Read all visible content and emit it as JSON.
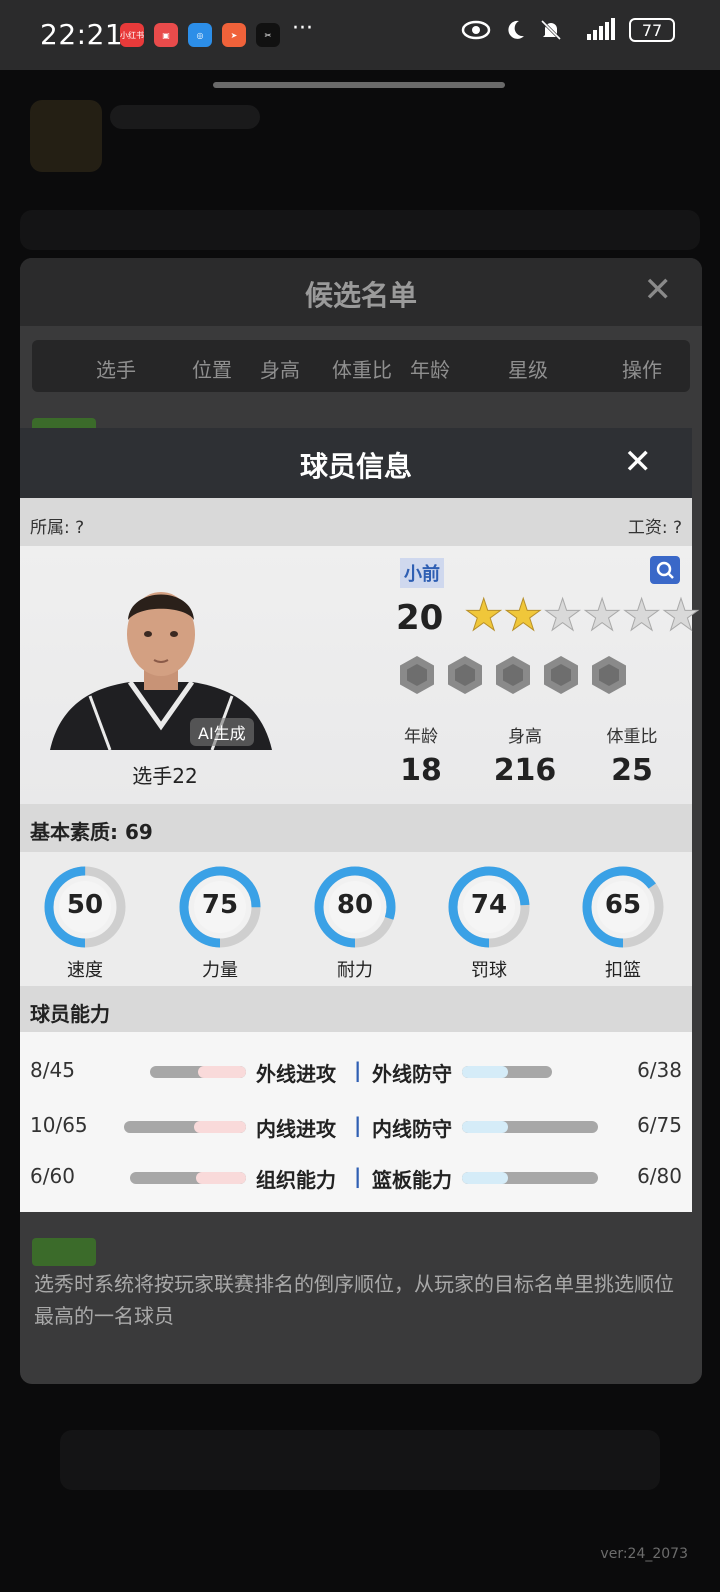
{
  "status_bar": {
    "time": "22:21",
    "apps": [
      {
        "icon": "xiaohongshu-icon",
        "label": "小红书",
        "color": "#e83a3a"
      },
      {
        "icon": "calendar-app-icon",
        "label": "",
        "color": "#e94b4b"
      },
      {
        "icon": "browser-icon",
        "label": "",
        "color": "#2c8ee8"
      },
      {
        "icon": "send-app-icon",
        "label": "",
        "color": "#f0623a"
      },
      {
        "icon": "capcut-icon",
        "label": "",
        "color": "#111111"
      }
    ],
    "more": "···",
    "battery": "77"
  },
  "candidate_list": {
    "title": "候选名单",
    "close_label": "✕",
    "columns": [
      "选手",
      "位置",
      "身高",
      "体重比",
      "年龄",
      "星级",
      "操作"
    ],
    "rule_text": "选秀时系统将按玩家联赛排名的倒序顺位，从玩家的目标名单里挑选顺位最高的一名球员"
  },
  "player_info": {
    "title": "球员信息",
    "close_label": "✕",
    "belong": "所属: ?",
    "salary": "工资: ?",
    "position": "小前",
    "overall": "20",
    "stars": {
      "filled": 2,
      "total": 6
    },
    "ai_badge": "AI生成",
    "name": "选手22",
    "attrs": [
      {
        "label": "年龄",
        "value": "18"
      },
      {
        "label": "身高",
        "value": "216"
      },
      {
        "label": "体重比",
        "value": "25"
      }
    ],
    "basic_quality_label": "基本素质: 69",
    "basic_stats": [
      {
        "label": "速度",
        "value": 50
      },
      {
        "label": "力量",
        "value": 75
      },
      {
        "label": "耐力",
        "value": 80
      },
      {
        "label": "罚球",
        "value": 74
      },
      {
        "label": "扣篮",
        "value": 65
      }
    ],
    "ability_label": "球员能力",
    "abilities": [
      {
        "left_value": "8/45",
        "left_name": "外线进攻",
        "right_name": "外线防守",
        "right_value": "6/38"
      },
      {
        "left_value": "10/65",
        "left_name": "内线进攻",
        "right_name": "内线防守",
        "right_value": "6/75"
      },
      {
        "left_value": "6/60",
        "left_name": "组织能力",
        "right_name": "篮板能力",
        "right_value": "6/80"
      }
    ]
  },
  "version": "ver:24_2073",
  "colors": {
    "ring": "#3aa1e6",
    "accent": "#2f5fb3"
  }
}
